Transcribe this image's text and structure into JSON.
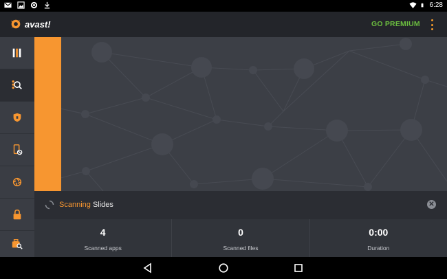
{
  "status_bar": {
    "time": "6:28",
    "left_icons": [
      "gmail-icon",
      "image-icon",
      "sync-icon",
      "download-icon"
    ],
    "right_icons": [
      "wifi-icon",
      "battery-icon"
    ]
  },
  "header": {
    "brand": "avast!",
    "go_premium": "GO PREMIUM",
    "menu_icon": "overflow-menu-icon",
    "accent_color": "#f79630",
    "premium_color": "#6bbd3f"
  },
  "sidebar": {
    "items": [
      {
        "name": "dashboard",
        "icon": "dashboard-icon"
      },
      {
        "name": "scan",
        "icon": "scan-icon",
        "active": true
      },
      {
        "name": "shield",
        "icon": "shield-icon"
      },
      {
        "name": "app-blocker",
        "icon": "phone-block-icon"
      },
      {
        "name": "network",
        "icon": "network-icon"
      },
      {
        "name": "app-locker",
        "icon": "lock-icon"
      },
      {
        "name": "privacy",
        "icon": "privacy-search-icon"
      }
    ]
  },
  "scan_status": {
    "label": "Scanning",
    "target": "Slides"
  },
  "stats": [
    {
      "value": "4",
      "label": "Scanned apps"
    },
    {
      "value": "0",
      "label": "Scanned files"
    },
    {
      "value": "0:00",
      "label": "Duration"
    }
  ],
  "nav_bar": {
    "buttons": [
      "back-icon",
      "home-icon",
      "recents-icon"
    ]
  }
}
